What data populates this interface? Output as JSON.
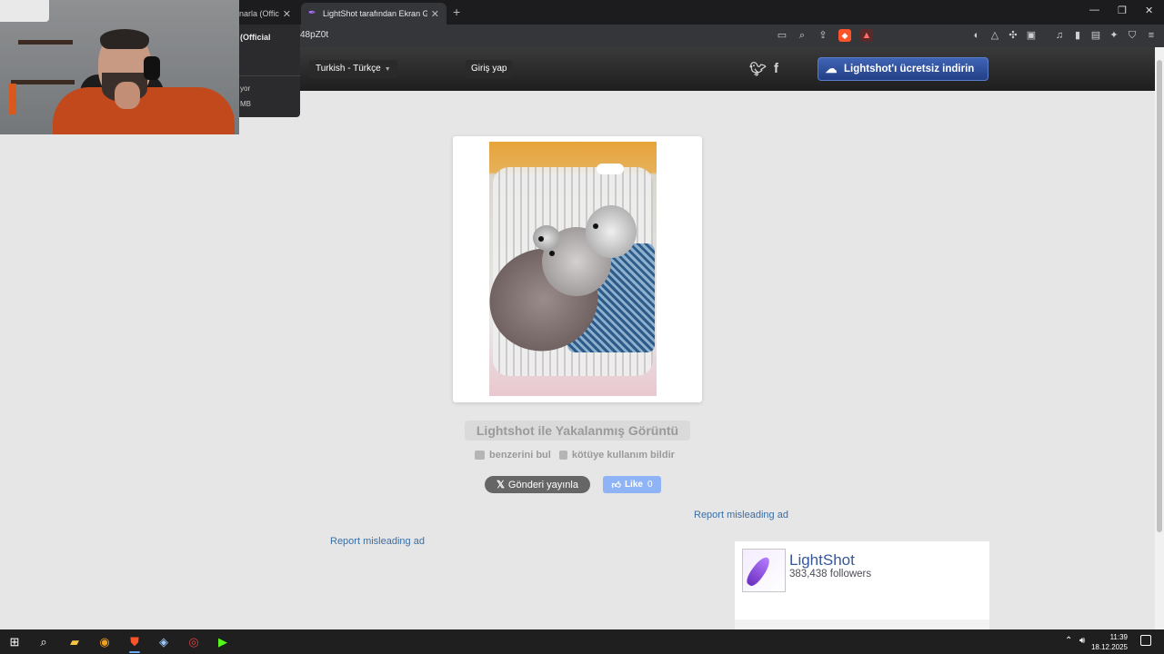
{
  "browser": {
    "tabs": [
      {
        "title": "narla (Offici",
        "active": false
      },
      {
        "title": "LightShot tarafından Ekran Görün",
        "active": true
      }
    ],
    "new_tab": "+",
    "url": "48pZ0t",
    "brave_badge": "▲",
    "window_controls": {
      "minimize": "—",
      "restore": "❐",
      "close": "✕"
    }
  },
  "overlay_menu": {
    "title": "(Official",
    "item1": "yor",
    "item2": "MB"
  },
  "site": {
    "language": "Turkish - Türkçe",
    "login": "Giriş yap",
    "twitter_icon": "twitter-icon",
    "facebook_icon": "facebook-icon",
    "download_button": "Lightshot'ı ücretsiz indirin"
  },
  "screenshot": {
    "title": "Lightshot ile Yakalanmış Görüntü",
    "find_similar": "benzerini bul",
    "report_abuse": "kötüye kullanım bildir",
    "post_button": "Gönderi yayınla",
    "like_label": "Like",
    "like_count": "0"
  },
  "ads": {
    "report_right": "Report misleading ad",
    "report_left": "Report misleading ad"
  },
  "fb_widget": {
    "page_name": "LightShot",
    "followers": "383,438 followers"
  },
  "taskbar": {
    "time": "11:39",
    "date": "18.12.2025"
  }
}
